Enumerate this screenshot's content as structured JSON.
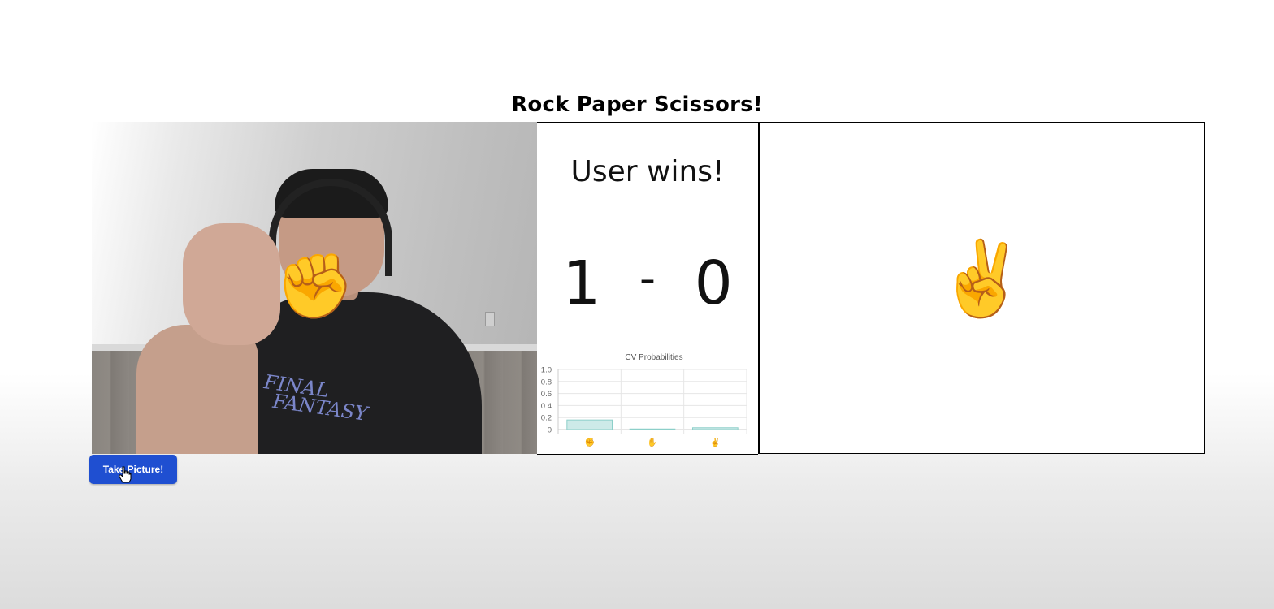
{
  "page": {
    "title": "Rock Paper Scissors!"
  },
  "webcam": {
    "shirt_text_line1": "FINAL",
    "shirt_text_line2": "FANTASY",
    "player_move_emoji": "✊"
  },
  "result_panel": {
    "message": "User wins!",
    "user_score": "1",
    "separator": "-",
    "computer_score": "0"
  },
  "computer_panel": {
    "move_emoji": "✌️"
  },
  "controls": {
    "take_picture_label": "Take Picture!"
  },
  "chart_data": {
    "type": "bar",
    "title": "CV Probabilities",
    "categories": [
      "✊",
      "✋",
      "✌"
    ],
    "values": [
      0.16,
      0.01,
      0.03
    ],
    "ylim": [
      0,
      1.0
    ],
    "yticks": [
      "1.0",
      "0.8",
      "0.6",
      "0.4",
      "0.2",
      "0"
    ],
    "grid": true,
    "colors": {
      "bar_fill": "#cdeae8",
      "bar_stroke": "#8ccfc9"
    }
  }
}
